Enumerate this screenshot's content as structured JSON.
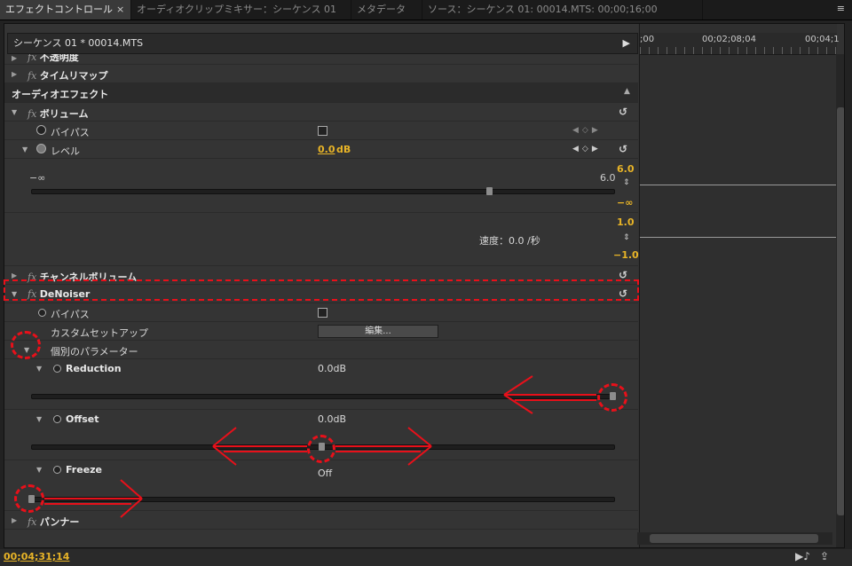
{
  "tabs": [
    {
      "label": "エフェクトコントロール",
      "close": "×",
      "active": true
    },
    {
      "label": "オーディオクリップミキサー：シーケンス 01",
      "active": false
    },
    {
      "label": "メタデータ",
      "active": false
    },
    {
      "label": "ソース：シーケンス 01: 00014.MTS: 00;00;16;00",
      "active": false
    }
  ],
  "panel_menu_icon": "≡",
  "sequence_header": {
    "title": "シーケンス 01 * 00014.MTS"
  },
  "ruler": {
    "t0": ";00",
    "t1": "00;02;08;04",
    "t2": "00;04;1"
  },
  "rows": {
    "opacity": "不透明度",
    "time_remap": "タイムリマップ",
    "audio_effects": "オーディオエフェクト",
    "volume": "ボリューム",
    "bypass": "バイパス",
    "level": "レベル",
    "level_value": "0.0",
    "level_unit": "dB",
    "level_min": "−∞",
    "level_max": "6.0",
    "speed": "速度：0.0 /秒",
    "graph_top1": "6.0",
    "graph_bottom1": "−∞",
    "graph_top2": "1.0",
    "graph_bottom2": "−1.0",
    "channel_volume": "チャンネルボリューム",
    "denoiser": "DeNoiser",
    "custom_setup": "カスタムセットアップ",
    "edit_button": "編集...",
    "individual_params": "個別のパラメーター",
    "reduction": "Reduction",
    "reduction_value": "0.0dB",
    "offset": "Offset",
    "offset_value": "0.0dB",
    "freeze": "Freeze",
    "freeze_value": "Off",
    "panner": "パンナー"
  },
  "fx_label": "fx",
  "status": {
    "timecode": "00;04;31;14"
  },
  "colors": {
    "accent": "#e8b427",
    "annotation": "#e8101a"
  }
}
